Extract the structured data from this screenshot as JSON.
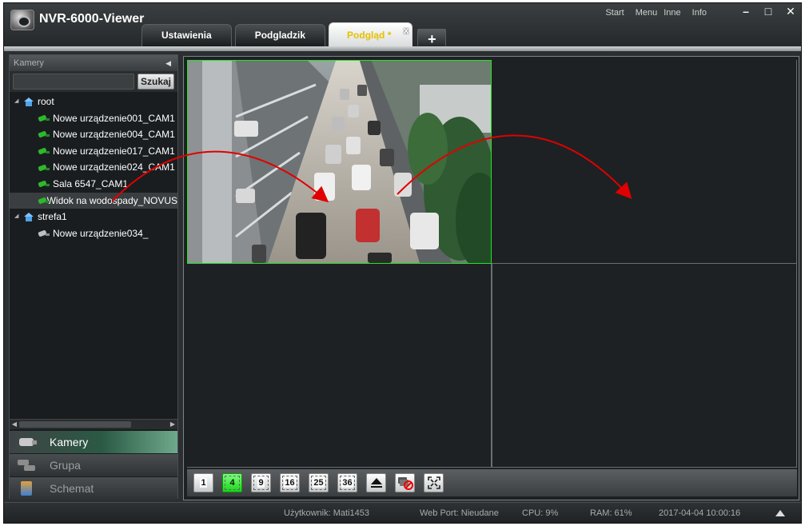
{
  "app": {
    "title": "NVR-6000-Viewer",
    "menu": [
      "Start",
      "Menu",
      "Inne",
      "Info"
    ],
    "window_controls": [
      "minimize-icon",
      "maximize-icon",
      "close-icon"
    ]
  },
  "tabs": [
    {
      "label": "Ustawienia",
      "active": false
    },
    {
      "label": "Podgladzik",
      "active": false
    },
    {
      "label": "Podgląd *",
      "active": true,
      "close": "x"
    },
    {
      "label": "+",
      "active": false
    }
  ],
  "sidebar": {
    "header": "Kamery",
    "search_placeholder": "",
    "search_button": "Szukaj",
    "tree": [
      {
        "label": "root",
        "type": "group",
        "icon": "home-icon"
      },
      {
        "label": "Nowe urządzenie001_CAM1",
        "type": "camera",
        "status": "online"
      },
      {
        "label": "Nowe urządzenie004_CAM1",
        "type": "camera",
        "status": "online"
      },
      {
        "label": "Nowe urządzenie017_CAM1",
        "type": "camera",
        "status": "online"
      },
      {
        "label": "Nowe urządzenie024_CAM1",
        "type": "camera",
        "status": "online"
      },
      {
        "label": "Sala 6547_CAM1",
        "type": "camera",
        "status": "online"
      },
      {
        "label": "Widok na wodospady_NOVUS",
        "type": "camera",
        "status": "online",
        "selected": true
      },
      {
        "label": "strefa1",
        "type": "group",
        "icon": "home-icon"
      },
      {
        "label": "Nowe urządzenie034_",
        "type": "camera",
        "status": "offline"
      }
    ],
    "sections": [
      {
        "label": "Kamery",
        "active": true
      },
      {
        "label": "Grupa",
        "active": false
      },
      {
        "label": "Schemat",
        "active": false
      }
    ]
  },
  "view": {
    "layout_buttons": [
      "1",
      "4",
      "9",
      "16",
      "25",
      "36"
    ],
    "active_layout": "4",
    "extra_buttons": [
      "eject-icon",
      "stop-all-cameras-icon",
      "fullscreen-icon"
    ],
    "colors": {
      "active_cell_border": "#22e622",
      "active_layout_button": "#17d717",
      "annotation_arrow": "#e00000"
    }
  },
  "status": {
    "user": "Użytkownik: Mati1453",
    "web_port": "Web Port: Nieudane",
    "cpu": "CPU: 9%",
    "ram": "RAM: 61%",
    "datetime": "2017-04-04 10:00:16"
  }
}
